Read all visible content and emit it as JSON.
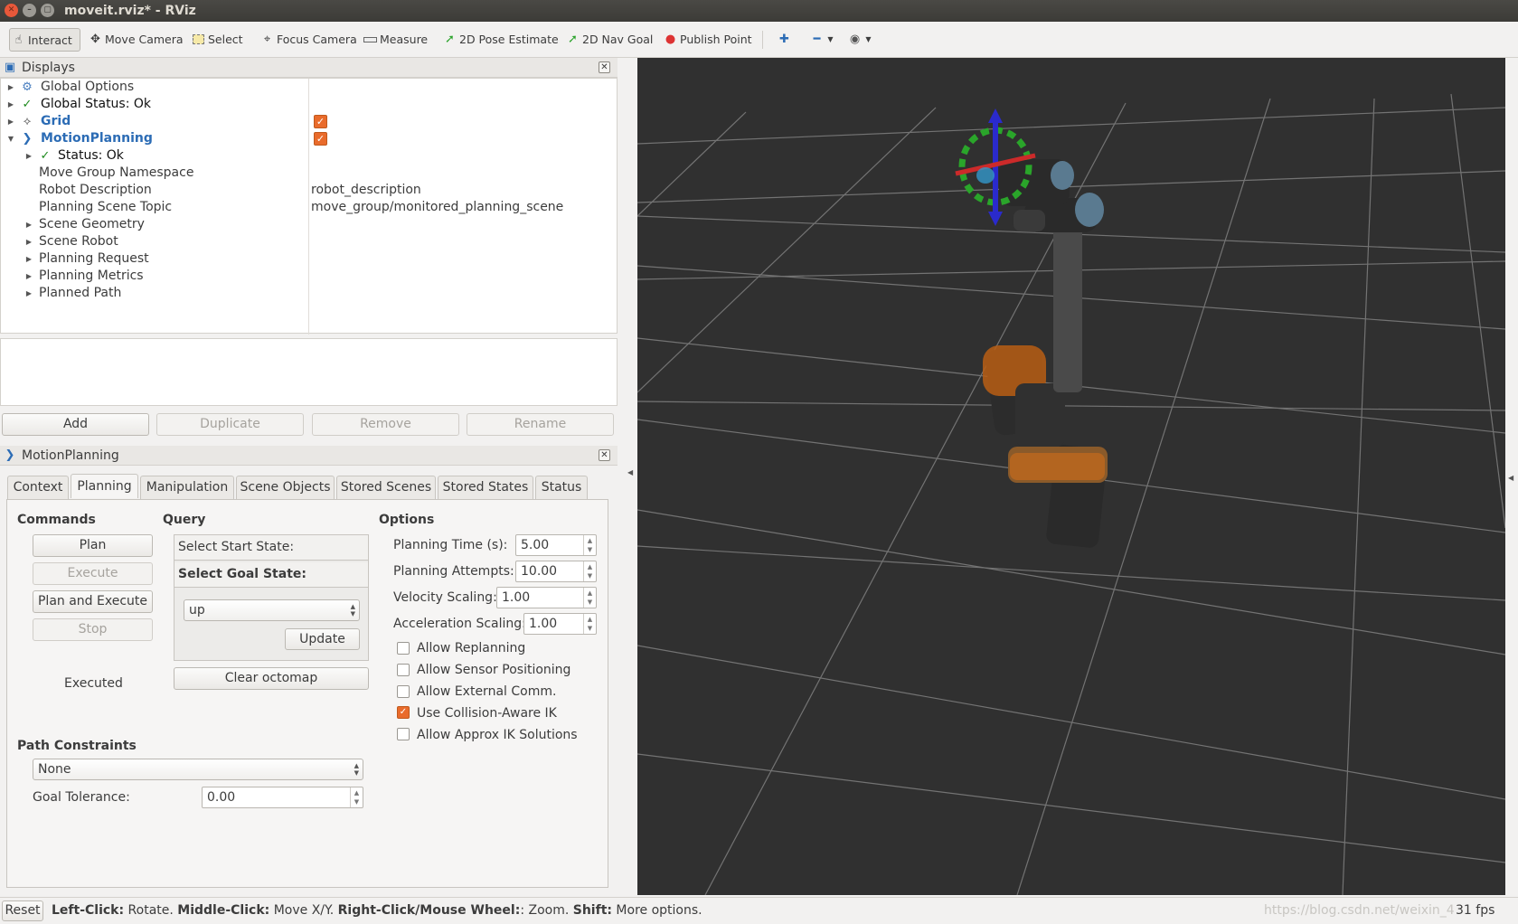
{
  "window": {
    "title": "moveit.rviz* - RViz"
  },
  "toolbar": {
    "tools": [
      {
        "label": "Interact",
        "icon": "hand-cursor-icon"
      },
      {
        "label": "Move Camera",
        "icon": "move-camera-icon"
      },
      {
        "label": "Select",
        "icon": "select-box-icon"
      },
      {
        "label": "Focus Camera",
        "icon": "focus-camera-icon"
      },
      {
        "label": "Measure",
        "icon": "ruler-icon"
      },
      {
        "label": "2D Pose Estimate",
        "icon": "green-arrow-icon"
      },
      {
        "label": "2D Nav Goal",
        "icon": "green-arrow-icon"
      },
      {
        "label": "Publish Point",
        "icon": "map-pin-icon"
      }
    ]
  },
  "displays": {
    "title": "Displays",
    "items": [
      {
        "label": "Global Options"
      },
      {
        "label": "Global Status: Ok"
      },
      {
        "label": "Grid"
      },
      {
        "label": "MotionPlanning"
      },
      {
        "label": "Status: Ok"
      },
      {
        "label": "Move Group Namespace",
        "value": ""
      },
      {
        "label": "Robot Description",
        "value": "robot_description"
      },
      {
        "label": "Planning Scene Topic",
        "value": "move_group/monitored_planning_scene"
      },
      {
        "label": "Scene Geometry"
      },
      {
        "label": "Scene Robot"
      },
      {
        "label": "Planning Request"
      },
      {
        "label": "Planning Metrics"
      },
      {
        "label": "Planned Path"
      }
    ],
    "buttons": {
      "add": "Add",
      "duplicate": "Duplicate",
      "remove": "Remove",
      "rename": "Rename"
    }
  },
  "motion_panel": {
    "title": "MotionPlanning",
    "tabs": [
      "Context",
      "Planning",
      "Manipulation",
      "Scene Objects",
      "Stored Scenes",
      "Stored States",
      "Status"
    ],
    "commands": {
      "heading": "Commands",
      "plan": "Plan",
      "execute": "Execute",
      "plan_execute": "Plan and Execute",
      "stop": "Stop",
      "status": "Executed"
    },
    "query": {
      "heading": "Query",
      "start_state": "Select Start State:",
      "goal_state": "Select Goal State:",
      "goal_value": "up",
      "update": "Update",
      "clear_octomap": "Clear octomap"
    },
    "options": {
      "heading": "Options",
      "planning_time_label": "Planning Time (s):",
      "planning_time": "5.00",
      "planning_attempts_label": "Planning Attempts:",
      "planning_attempts": "10.00",
      "velocity_label": "Velocity Scaling:",
      "velocity": "1.00",
      "acceleration_label": "Acceleration Scaling:",
      "acceleration": "1.00",
      "checks": [
        {
          "label": "Allow Replanning",
          "checked": false
        },
        {
          "label": "Allow Sensor Positioning",
          "checked": false
        },
        {
          "label": "Allow External Comm.",
          "checked": false
        },
        {
          "label": "Use Collision-Aware IK",
          "checked": true
        },
        {
          "label": "Allow Approx IK Solutions",
          "checked": false
        }
      ]
    },
    "path_constraints": {
      "heading": "Path Constraints",
      "value": "None",
      "goal_tolerance_label": "Goal Tolerance:",
      "goal_tolerance": "0.00"
    }
  },
  "statusbar": {
    "reset": "Reset",
    "hint_b1": "Left-Click:",
    "hint_t1": " Rotate. ",
    "hint_b2": "Middle-Click:",
    "hint_t2": " Move X/Y. ",
    "hint_b3": "Right-Click/Mouse Wheel:",
    "hint_t3": ": Zoom. ",
    "hint_b4": "Shift:",
    "hint_t4": " More options.",
    "watermark": "https://blog.csdn.net/weixin_4",
    "fps": "31 fps"
  },
  "colors": {
    "accent": "#e96b2b",
    "link": "#2c6cb5",
    "viewport": "#303030"
  }
}
